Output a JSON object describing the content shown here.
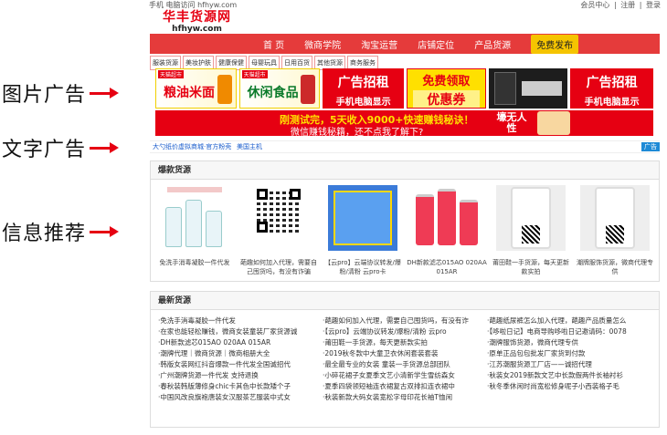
{
  "annotations": {
    "image_ads": "图片广告",
    "text_ads": "文字广告",
    "info_recommend": "信息推荐"
  },
  "topbar": {
    "left": "手机 电脑访问 hfhyw.com",
    "links": [
      "会员中心",
      "|",
      "注册",
      "|",
      "登录"
    ]
  },
  "logo": {
    "cn": "华丰货源网",
    "en": "hfhyw.com"
  },
  "nav": {
    "items": [
      "首 页",
      "微商学院",
      "淘宝运营",
      "店铺定位",
      "产品货源"
    ],
    "active": "免费发布"
  },
  "subnav": [
    "服装货源",
    "美妆护肤",
    "健康保健",
    "母婴玩具",
    "日用百货",
    "其他货源",
    "商务服务"
  ],
  "image_ads": {
    "food_tag": "天猫超市",
    "food_text": "粮油米面",
    "snack_tag": "天猫超市",
    "snack_text": "休闲食品",
    "rent1_l1": "广告招租",
    "rent1_l2": "手机电脑显示",
    "coupon_l1": "免费领取",
    "coupon_l2": "优惠券",
    "rent2_l1": "广告招租",
    "rent2_l2": "手机电脑显示",
    "banner_l1": "刚测试完，5天收入9000+快速赚钱秘诀！",
    "banner_l2": "微信赚钱秘籍，还不点我了解下?",
    "banner_right": "壕无人性"
  },
  "text_ads": {
    "items": [
      "大勺纸价虚拟商城·官方粉壳",
      "美国主机"
    ],
    "badge": "广告"
  },
  "hot": {
    "title": "爆款货源",
    "items": [
      {
        "caption": "免洗手消毒凝胶一件代发"
      },
      {
        "caption": "葩趣如何加入代理，需要自己囤货吗，有没有诈骗"
      },
      {
        "caption": "【云pro】云端协议转发/爆粉/清粉 云pro卡"
      },
      {
        "caption": "DH新款滤芯015AO 020AA 015AR"
      },
      {
        "caption": "莆田鞋一手货源，每天更新款实拍"
      },
      {
        "caption": "潮牌服饰货源，微商代理专供"
      }
    ]
  },
  "latest": {
    "title": "最新货源",
    "col1": [
      "·免洗手消毒凝胶一件代发",
      "·在家也能轻松赚钱，微商女装童装厂家货源诚",
      "·DH新款滤芯015AO 020AA 015AR",
      "·潮牌代理｜微商货源｜微商相册大全",
      "·韩版女装网红抖音爆款一件代发全国诚招代",
      "·广州潮牌货源一件代发 支持退换",
      "·春秋装韩版薄修身chic卡其色中长款矮个子",
      "·中国风改良旗袍唐装女汉服茶艺服装中式女"
    ],
    "col2": [
      "·葩趣如何加入代理，需要自己囤货吗，有没有诈",
      "·【云pro】云端协议转发/爆粉/清粉 云pro",
      "·莆田鞋一手货源，每天更新款实拍",
      "·2019秋冬款中大童卫衣休闲套装套装",
      "·最全最专业的女装 童装一手货源总部团队",
      "·小碎花裙子女夏季文艺小清新学生雪纺森女",
      "·夏季四袋领短袖连衣裙复古双排扣连衣裙中",
      "·秋装新款大码女装宽松字母印花长袖T恤闲"
    ],
    "col3": [
      "·葩趣纸尿裤怎么加入代理，葩趣产品质量怎么",
      "·【哆啦日记】电商导购哆啦日记邀请码：0078",
      "·潮牌服饰货源，微商代理专供",
      "·原单正品包包批发厂家货到付款",
      "·江苏潮服货源工厂店——诚招代理",
      "·秋装女2019新款文艺中长款假两件长袖衬衫",
      "·秋冬季休闲时尚宽松修身呢子小西装格子毛"
    ]
  },
  "colors": {
    "brand_red": "#e60012",
    "nav_red": "#e53b3b",
    "nav_active": "#f5c400",
    "link_blue": "#1a5ccc"
  }
}
